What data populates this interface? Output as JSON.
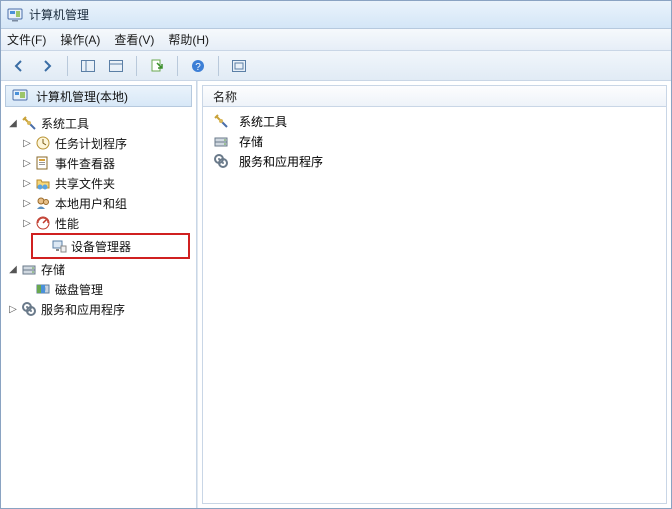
{
  "title": "计算机管理",
  "menu": {
    "file": "文件(F)",
    "action": "操作(A)",
    "view": "查看(V)",
    "help": "帮助(H)"
  },
  "toolbar": {
    "back": "back",
    "forward": "forward",
    "up": "up",
    "show_hide": "show-hide",
    "export": "export",
    "help": "help",
    "refresh": "refresh"
  },
  "tree": {
    "root": "计算机管理(本地)",
    "system_tools": "系统工具",
    "task_scheduler": "任务计划程序",
    "event_viewer": "事件查看器",
    "shared_folders": "共享文件夹",
    "local_users": "本地用户和组",
    "performance": "性能",
    "device_manager": "设备管理器",
    "storage": "存储",
    "disk_management": "磁盘管理",
    "services_apps": "服务和应用程序"
  },
  "list": {
    "column_name": "名称",
    "items": {
      "system_tools": "系统工具",
      "storage": "存储",
      "services_apps": "服务和应用程序"
    }
  },
  "glyph": {
    "expanded": "◢",
    "collapsed": "▷"
  }
}
